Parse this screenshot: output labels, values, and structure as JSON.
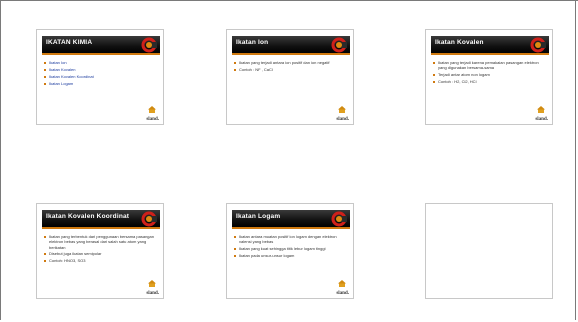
{
  "slides": [
    {
      "title": "IKATAN KIMIA",
      "items": [
        "Ikatan Ion",
        "Ikatan Kovalen",
        "Ikatan Kovalen Koordinat",
        "Ikatan Logam"
      ],
      "brand": "sland."
    },
    {
      "title": "Ikatan Ion",
      "items": [
        "Ikatan yang terjadi antara ion positif dan ion negatif",
        "Contoh : NF , CaCl"
      ],
      "brand": "sland."
    },
    {
      "title": "Ikatan Kovalen",
      "items": [
        "Ikatan yang terjadi karena pemakaian pasangan elektron yang digunakan bersama-sama",
        "Terjadi antar atom non logam",
        "Contoh : H2, Cl2, HCl"
      ],
      "brand": "sland."
    },
    {
      "title": "Ikatan Kovalen Koordinat",
      "items": [
        "Ikatan yang terbentuk dari penggunaan bersama pasangan elektron bebas yang berasal dari salah satu atom yang berikatan",
        "Disebut juga ikatan semipolar",
        "Contoh: HNO3, SO3"
      ],
      "brand": "sland."
    },
    {
      "title": "Ikatan Logam",
      "items": [
        "Ikatan antara muatan positif ion logam dengan elektron valensi yang bebas",
        "Ikatan yang kuat sehingga titik lebur logam tinggi",
        "Ikatan pada unsur-unsur logam"
      ],
      "brand": "sland."
    },
    {
      "title": "",
      "items": [],
      "brand": ""
    }
  ]
}
